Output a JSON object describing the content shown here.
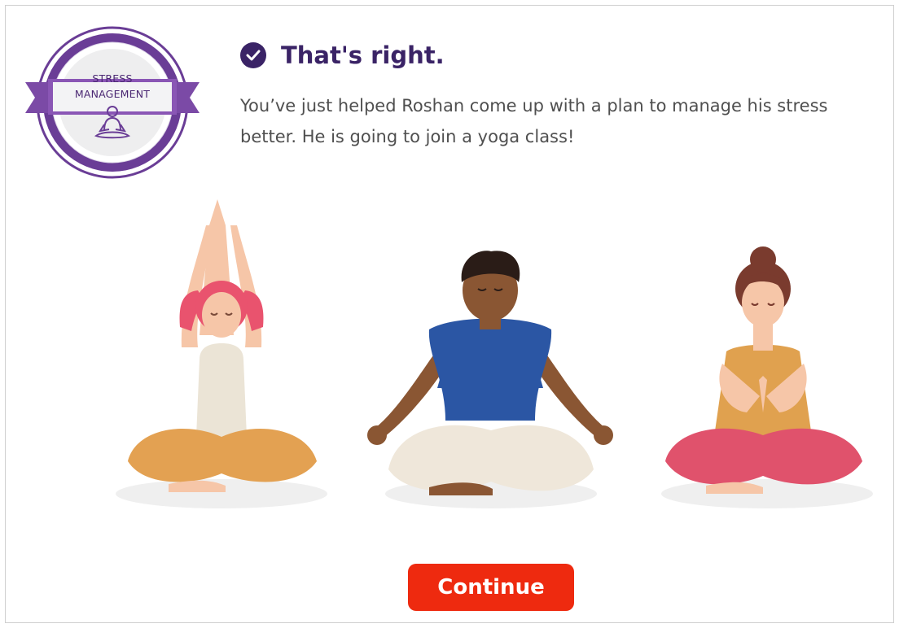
{
  "badge": {
    "line1": "STRESS",
    "line2": "MANAGEMENT",
    "icon": "meditating-person-icon"
  },
  "feedback": {
    "title": "That's right.",
    "icon": "check-circle-icon",
    "body": "You’ve just helped Roshan come up with a plan to manage his stress better. He is going to join a yoga class!"
  },
  "illustration": {
    "figures": [
      "yoga-woman-arms-raised",
      "yoga-man-meditating",
      "yoga-woman-prayer-hands"
    ]
  },
  "actions": {
    "continue_label": "Continue"
  },
  "colors": {
    "brand_purple": "#3a2366",
    "badge_purple": "#6a3d96",
    "continue_red": "#ee2a0f",
    "text_gray": "#4f4f4f"
  }
}
